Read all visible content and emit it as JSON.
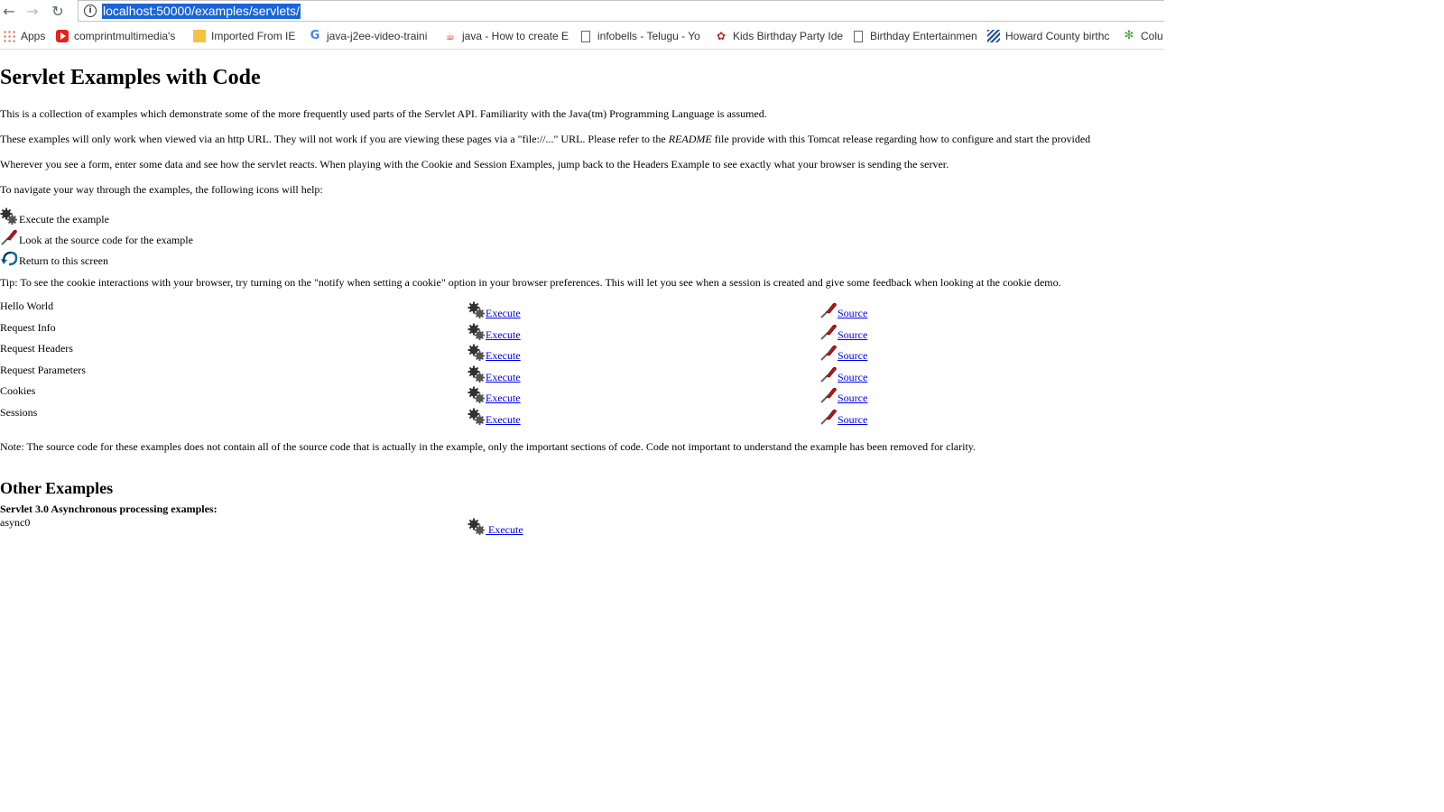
{
  "browser": {
    "url": "localhost:50000/examples/servlets/",
    "bookmarks": [
      {
        "label": "Apps",
        "icon": "apps-icon"
      },
      {
        "label": "comprintmultimedia's",
        "icon": "youtube-icon"
      },
      {
        "label": "Imported From IE",
        "icon": "folder-icon"
      },
      {
        "label": "java-j2ee-video-traini",
        "icon": "google-icon"
      },
      {
        "label": "java - How to create E",
        "icon": "java-icon"
      },
      {
        "label": "infobells - Telugu - Yo",
        "icon": "page-icon"
      },
      {
        "label": "Kids Birthday Party Ide",
        "icon": "kids-icon"
      },
      {
        "label": "Birthday Entertainmen",
        "icon": "page-icon"
      },
      {
        "label": "Howard County birthc",
        "icon": "howard-county-icon"
      },
      {
        "label": "Colu",
        "icon": "star-icon"
      }
    ]
  },
  "page": {
    "title": "Servlet Examples with Code",
    "intro": "This is a collection of examples which demonstrate some of the more frequently used parts of the Servlet API. Familiarity with the Java(tm) Programming Language is assumed.",
    "http_note_before": "These examples will only work when viewed via an http URL. They will not work if you are viewing these pages via a \"file://...\" URL. Please refer to the ",
    "http_note_readme": "README",
    "http_note_after": " file provide with this Tomcat release regarding how to configure and start the provided",
    "form_note": "Wherever you see a form, enter some data and see how the servlet reacts. When playing with the Cookie and Session Examples, jump back to the Headers Example to see exactly what your browser is sending the server.",
    "nav_note": "To navigate your way through the examples, the following icons will help:",
    "legend": [
      {
        "icon": "execute-gear-icon",
        "label": "Execute the example"
      },
      {
        "icon": "source-pen-icon",
        "label": "Look at the source code for the example"
      },
      {
        "icon": "return-arrow-icon",
        "label": "Return to this screen"
      }
    ],
    "tip": "Tip: To see the cookie interactions with your browser, try turning on the \"notify when setting a cookie\" option in your browser preferences. This will let you see when a session is created and give some feedback when looking at the cookie demo.",
    "examples": [
      {
        "name": "Hello World",
        "execute": "Execute",
        "source": "Source"
      },
      {
        "name": "Request Info",
        "execute": "Execute",
        "source": "Source"
      },
      {
        "name": "Request Headers",
        "execute": "Execute",
        "source": "Source"
      },
      {
        "name": "Request Parameters",
        "execute": "Execute",
        "source": "Source"
      },
      {
        "name": "Cookies",
        "execute": "Execute",
        "source": "Source"
      },
      {
        "name": "Sessions",
        "execute": "Execute",
        "source": "Source"
      }
    ],
    "source_note": "Note: The source code for these examples does not contain all of the source code that is actually in the example, only the important sections of code. Code not important to understand the example has been removed for clarity.",
    "other_title": "Other Examples",
    "async_heading": "Servlet 3.0 Asynchronous processing examples:",
    "async_name": "async0",
    "async_execute": " Execute"
  }
}
